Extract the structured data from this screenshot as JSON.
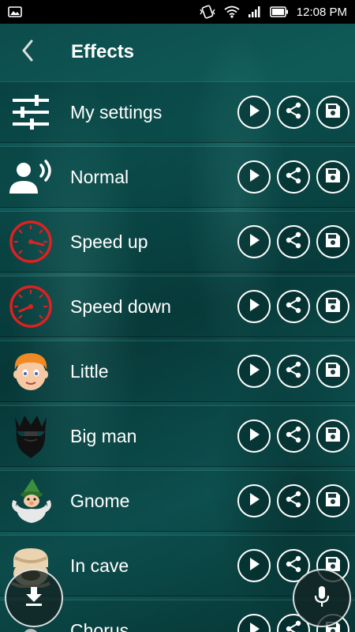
{
  "status_bar": {
    "time": "12:08 PM",
    "icons": [
      "image-icon",
      "vibrate-icon",
      "wifi-icon",
      "signal-icon",
      "battery-icon"
    ]
  },
  "app_bar": {
    "title": "Effects",
    "back_icon": "chevron-left-icon"
  },
  "effects": [
    {
      "label": "My settings",
      "icon": "sliders-icon"
    },
    {
      "label": "Normal",
      "icon": "person-voice-icon"
    },
    {
      "label": "Speed up",
      "icon": "speedometer-icon"
    },
    {
      "label": "Speed down",
      "icon": "speedometer-icon"
    },
    {
      "label": "Little",
      "icon": "child-face-icon"
    },
    {
      "label": "Big man",
      "icon": "bearded-man-icon"
    },
    {
      "label": "Gnome",
      "icon": "gnome-icon"
    },
    {
      "label": "In cave",
      "icon": "cave-man-icon"
    },
    {
      "label": "Chorus",
      "icon": "chorus-icon"
    }
  ],
  "row_actions": [
    "play-icon",
    "share-icon",
    "save-icon"
  ],
  "fabs": {
    "left": "download-icon",
    "right": "microphone-icon"
  },
  "colors": {
    "background": "#0f5a58",
    "status_bar": "#000000",
    "speedometer_red": "#e02020"
  }
}
